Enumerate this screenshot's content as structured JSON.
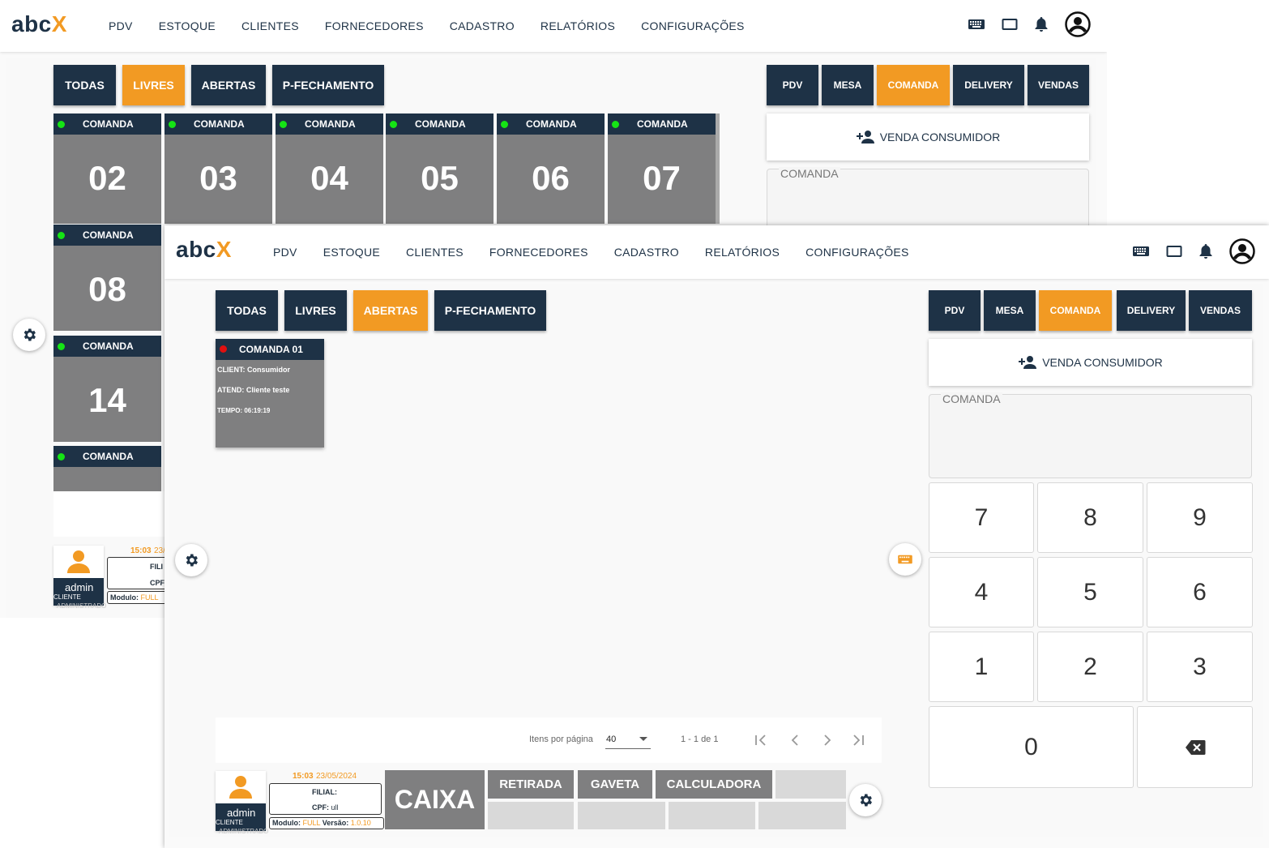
{
  "app": {
    "logo_main": "abc",
    "logo_accent": "X"
  },
  "nav": [
    "PDV",
    "ESTOQUE",
    "CLIENTES",
    "FORNECEDORES",
    "CADASTRO",
    "RELATÓRIOS",
    "CONFIGURAÇÕES"
  ],
  "top_icons": [
    "keyboard-icon",
    "tablet-icon",
    "bell-icon",
    "account-icon"
  ],
  "filters": [
    "TODAS",
    "LIVRES",
    "ABERTAS",
    "P-FECHAMENTO"
  ],
  "modes": [
    "PDV",
    "MESA",
    "COMANDA",
    "DELIVERY",
    "VENDAS"
  ],
  "venda_consumidor": "VENDA CONSUMIDOR",
  "comanda_field_label": "COMANDA",
  "back_window": {
    "active_filter": "LIVRES",
    "active_mode": "COMANDA",
    "card_header": "COMANDA",
    "cards_row": [
      "02",
      "03",
      "04",
      "05",
      "06",
      "07"
    ],
    "cards_col": [
      "08",
      "14",
      ""
    ],
    "user": {
      "time": "15:03",
      "date_partial": "23/",
      "filial_partial": "FILI",
      "cpf_partial": "CPF",
      "modulo_label": "Modulo:",
      "modulo_value": "FULL",
      "name": "admin",
      "role": "CLIENTE",
      "role2": "ADMINISTRADO"
    }
  },
  "front_window": {
    "active_filter": "ABERTAS",
    "active_mode": "COMANDA",
    "open_comanda": {
      "title": "COMANDA 01",
      "client": "CLIENT: Consumidor",
      "atend": "ATEND: Cliente teste",
      "tempo": "TEMPO: 06:19:19",
      "status_color": "#e01010"
    },
    "keypad": [
      "7",
      "8",
      "9",
      "4",
      "5",
      "6",
      "1",
      "2",
      "3",
      "0"
    ],
    "backspace_icon": "backspace-icon",
    "pagination": {
      "items_label": "Itens por página",
      "page_size": "40",
      "range": "1 - 1 de 1"
    },
    "user": {
      "time": "15:03",
      "date": "23/05/2024",
      "filial_label": "FILIAL:",
      "cpf_label": "CPF:",
      "cpf_value": "ull",
      "modulo_label": "Modulo:",
      "modulo_value": "FULL",
      "versao_label": "Versão:",
      "versao_value": "1.0.10",
      "name": "admin",
      "role": "CLIENTE",
      "role2": "ADMINISTRADO"
    },
    "caixa": "CAIXA",
    "actions": [
      "RETIRADA",
      "GAVETA",
      "CALCULADORA"
    ]
  },
  "colors": {
    "navy": "#1e3246",
    "orange": "#f29a23",
    "gray": "#7f7f80",
    "green": "#15e415",
    "red": "#e01010"
  }
}
